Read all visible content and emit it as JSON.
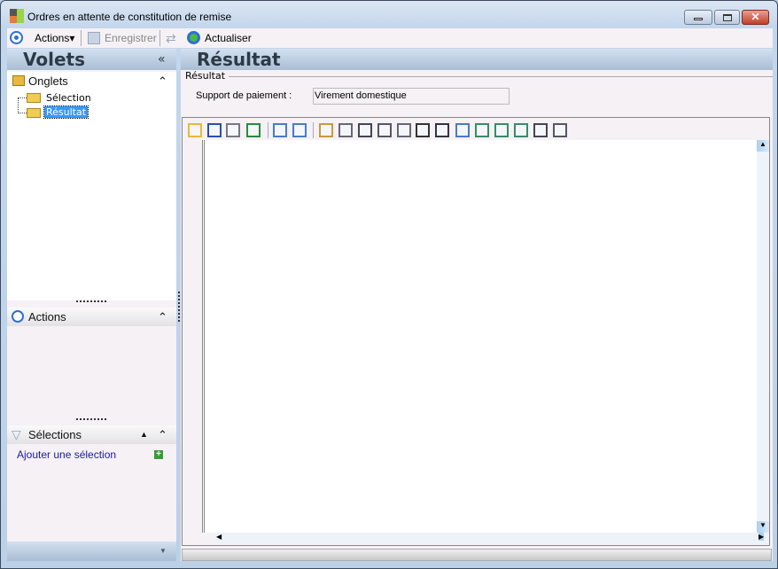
{
  "window": {
    "title": "Ordres en attente de constitution de remise"
  },
  "toolbar": {
    "actions": "Actions",
    "save": "Enregistrer",
    "refresh": "Actualiser"
  },
  "left": {
    "header": "Volets",
    "collapse": "«",
    "onglets": {
      "title": "Onglets",
      "items": [
        "Sélection",
        "Résultat"
      ],
      "selected": "Résultat"
    },
    "actions": {
      "title": "Actions"
    },
    "selections": {
      "title": "Sélections",
      "add_link": "Ajouter une sélection"
    }
  },
  "main": {
    "header": "Résultat",
    "group_title": "Résultat",
    "field_label": "Support de paiement :",
    "field_value": "Virement domestique",
    "grid_toolbar": [
      "open",
      "save",
      "print",
      "excel",
      "rows",
      "columns",
      "add-table",
      "grid",
      "grid-lines",
      "grid-lines-2",
      "filter",
      "sum-down",
      "sum",
      "column-width",
      "row-layout",
      "column-layout",
      "group-layout",
      "add-row",
      "remove-row"
    ]
  }
}
